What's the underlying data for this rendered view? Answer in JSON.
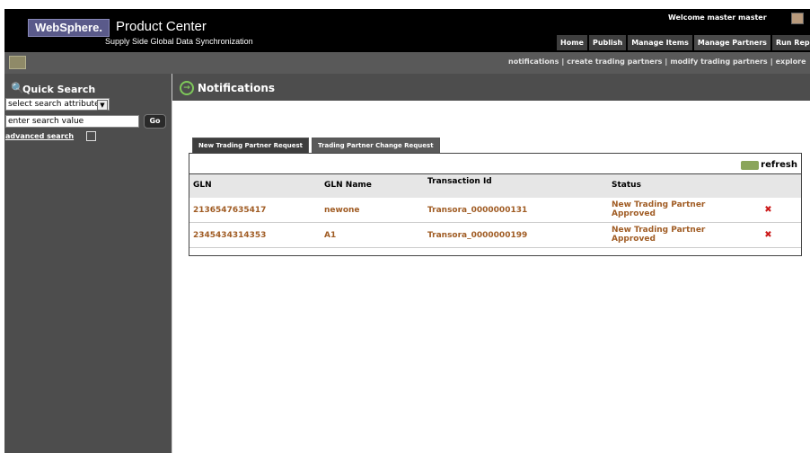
{
  "header": {
    "logo": "WebSphere.",
    "product_title": "Product Center",
    "subtitle": "Supply Side Global Data Synchronization",
    "welcome": "Welcome  master master",
    "nav_tabs": [
      {
        "label": "Home"
      },
      {
        "label": "Publish"
      },
      {
        "label": "Manage Items"
      },
      {
        "label": "Manage Partners"
      },
      {
        "label": "Run Reports"
      }
    ]
  },
  "subnav": {
    "links": [
      "notifications",
      "create trading partners",
      "modify trading partners",
      "explore"
    ]
  },
  "sidebar": {
    "title": "Quick Search",
    "select_value": "select search attribute",
    "input_placeholder": "enter search value",
    "go_label": "Go",
    "advanced_search": "advanced search"
  },
  "main": {
    "title": "Notifications",
    "tabs": [
      {
        "label": "New Trading Partner Request"
      },
      {
        "label": "Trading Partner Change Request"
      }
    ],
    "refresh_label": "refresh",
    "columns": [
      "GLN",
      "GLN Name",
      "Transaction Id",
      "Status"
    ],
    "rows": [
      {
        "gln": "2136547635417",
        "gln_name": "newone",
        "transaction_id": "Transora_0000000131",
        "status": "New Trading Partner Approved"
      },
      {
        "gln": "2345434314353",
        "gln_name": "A1",
        "transaction_id": "Transora_0000000199",
        "status": "New Trading Partner Approved"
      }
    ]
  },
  "colors": {
    "header_bg": "#000000",
    "sidebar_bg": "#4d4d4d",
    "link_text": "#a05c24",
    "delete_icon": "#cc1a1a"
  }
}
